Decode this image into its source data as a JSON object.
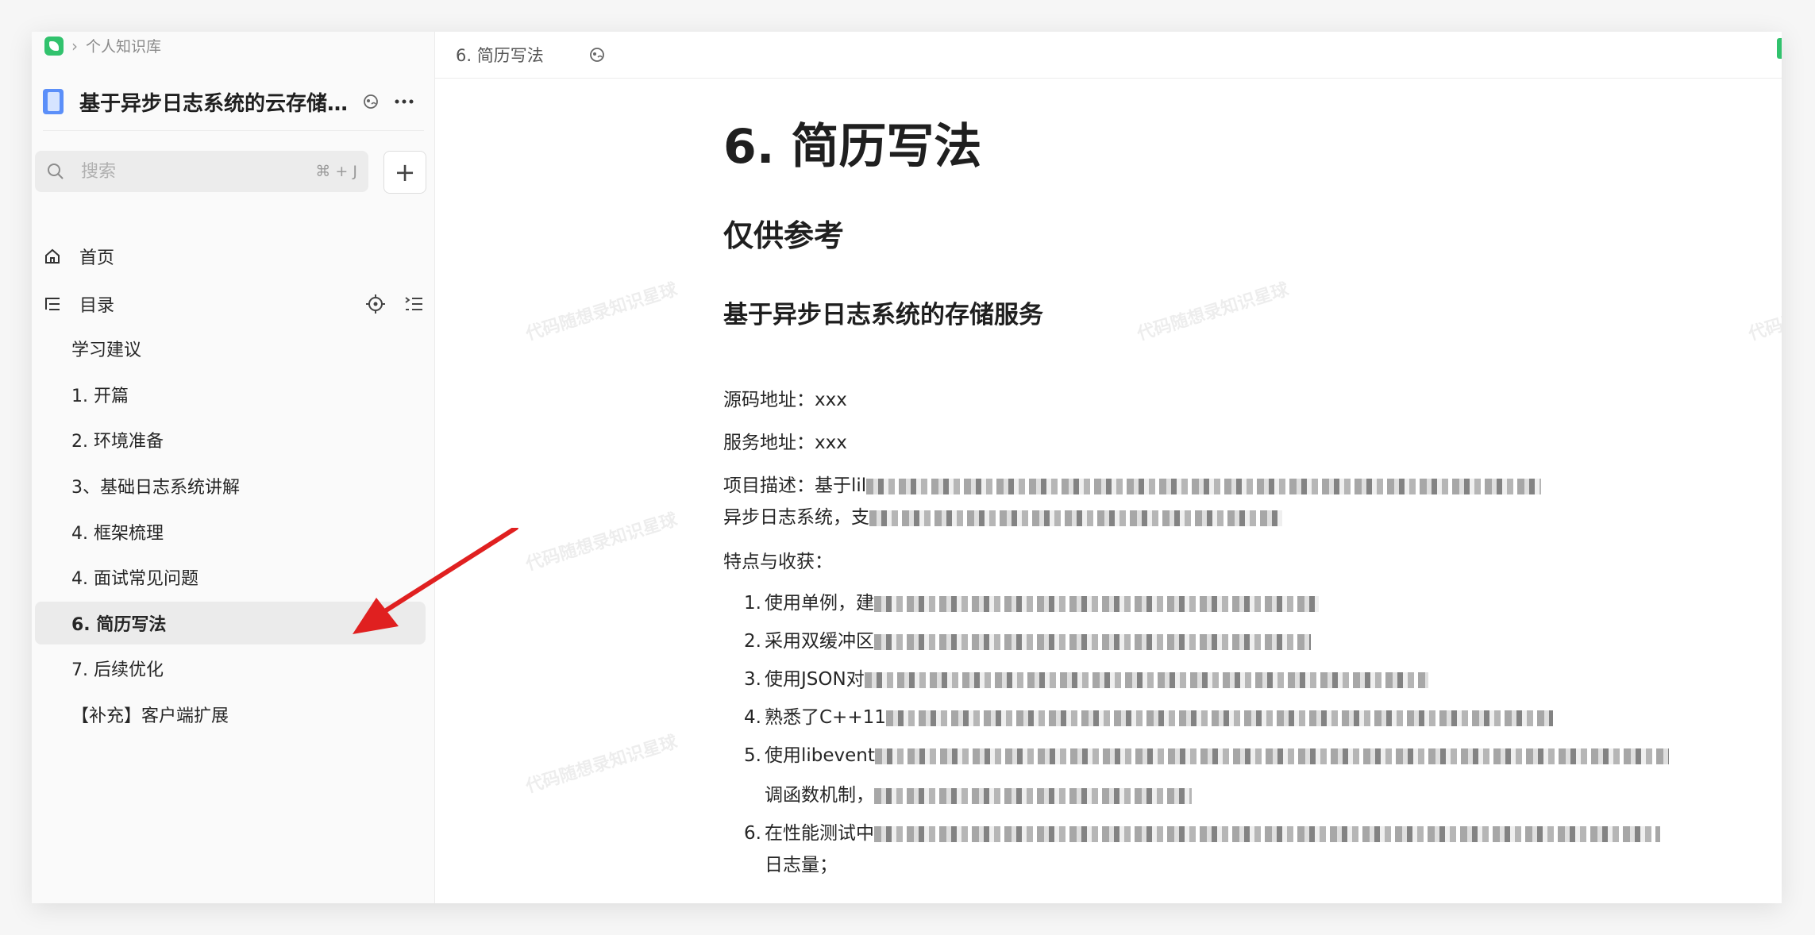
{
  "breadcrumb": {
    "label": "个人知识库"
  },
  "book": {
    "title": "基于异步日志系统的云存储..."
  },
  "search": {
    "placeholder": "搜索",
    "shortcut": "⌘ + J"
  },
  "add": {
    "label": "+"
  },
  "nav": {
    "home": "首页",
    "toc": "目录"
  },
  "toc_items": [
    "学习建议",
    "1. 开篇",
    "2. 环境准备",
    "3、基础日志系统讲解",
    "4. 框架梳理",
    "4. 面试常见问题",
    "6. 简历写法",
    "7. 后续优化",
    "【补充】客户端扩展"
  ],
  "active_item": "6. 简历写法",
  "topbar": {
    "doc_title": "6. 简历写法"
  },
  "doc": {
    "h1": "6. 简历写法",
    "h2": "仅供参考",
    "h3": "基于异步日志系统的存储服务",
    "source": "源码地址：xxx",
    "service": "服务地址：xxx",
    "desc_prefix": "项目描述：基于lil",
    "desc_line2_prefix": "异步日志系统，支",
    "features_label": "特点与收获：",
    "list": [
      {
        "num": "1.",
        "text": "使用单例，建"
      },
      {
        "num": "2.",
        "text": "采用双缓冲区"
      },
      {
        "num": "3.",
        "text": "使用JSON对"
      },
      {
        "num": "4.",
        "text": "熟悉了C++11"
      },
      {
        "num": "5.",
        "text": "使用libevent",
        "line2": "调函数机制，"
      },
      {
        "num": "6.",
        "text": "在性能测试中",
        "line2": "日志量；"
      }
    ]
  },
  "watermark": "代码随想录知识星球",
  "colors": {
    "brand_green": "#31c26d",
    "active_bg": "#ebebeb",
    "arrow": "#e02020"
  }
}
